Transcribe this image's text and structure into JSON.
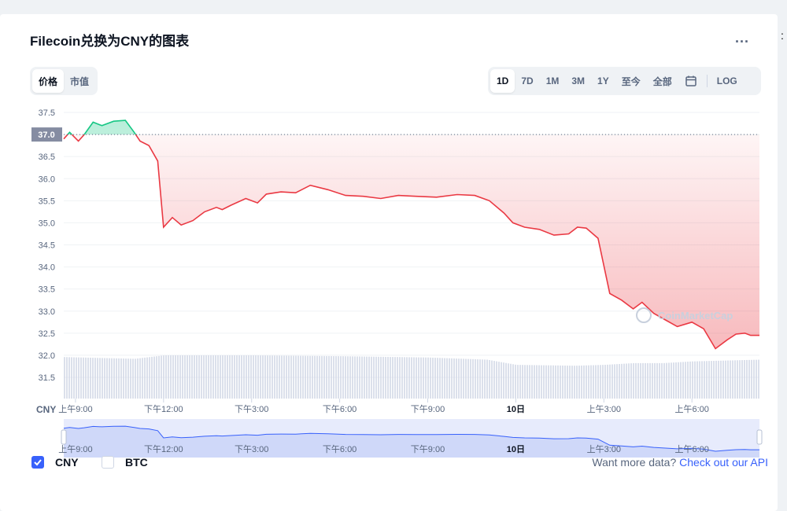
{
  "header": {
    "title": "Filecoin兑换为CNY的图表",
    "more_label": "..."
  },
  "metric_tabs": [
    {
      "label": "价格",
      "active": true
    },
    {
      "label": "市值",
      "active": false
    }
  ],
  "range_tabs": [
    {
      "label": "1D",
      "active": true
    },
    {
      "label": "7D",
      "active": false
    },
    {
      "label": "1M",
      "active": false
    },
    {
      "label": "3M",
      "active": false
    },
    {
      "label": "1Y",
      "active": false
    },
    {
      "label": "至今",
      "active": false
    },
    {
      "label": "全部",
      "active": false
    }
  ],
  "log_label": "LOG",
  "footer": {
    "options": [
      {
        "label": "CNY",
        "checked": true
      },
      {
        "label": "BTC",
        "checked": false
      }
    ],
    "api_text": "Want more data?",
    "api_link": "Check out our API"
  },
  "watermark": "CoinMarketCap",
  "colors": {
    "up": "#16c784",
    "down": "#ea3943",
    "accent": "#3861fb",
    "navigator_fill": "#dde3fb",
    "volume": "#cfd6e4"
  },
  "chart_data": {
    "type": "line",
    "ylabel": "CNY",
    "reference_price": 37.0,
    "ylim": [
      31.0,
      37.7
    ],
    "y_ticks": [
      "37.5",
      "37.0",
      "36.5",
      "36.0",
      "35.5",
      "35.0",
      "34.5",
      "34.0",
      "33.5",
      "33.0",
      "32.5",
      "32.0",
      "31.5"
    ],
    "x_ticks": [
      "上午9:00",
      "下午12:00",
      "下午3:00",
      "下午6:00",
      "下午9:00",
      "10日",
      "上午3:00",
      "上午6:00"
    ],
    "x_tick_hours": [
      0,
      3,
      6,
      9,
      12,
      15,
      18,
      21
    ],
    "x_range_hours": [
      -0.4,
      23.3
    ],
    "series": [
      {
        "hours": [
          -0.4,
          -0.2,
          0.1,
          0.3,
          0.6,
          0.9,
          1.3,
          1.7,
          2.0,
          2.2,
          2.5,
          2.8,
          3.0,
          3.3,
          3.6,
          4.0,
          4.4,
          4.8,
          5.0,
          5.3,
          5.8,
          6.2,
          6.5,
          7.0,
          7.5,
          8.0,
          8.6,
          9.2,
          9.8,
          10.4,
          11.0,
          11.6,
          12.3,
          13.0,
          13.6,
          14.1,
          14.6,
          14.9,
          15.3,
          15.8,
          16.3,
          16.8,
          17.1,
          17.4,
          17.8,
          18.2,
          18.6,
          19.0,
          19.3,
          19.7,
          20.1,
          20.5,
          21.0,
          21.4,
          21.8,
          22.2,
          22.5,
          22.8,
          23.0,
          23.3
        ],
        "values": [
          36.9,
          37.05,
          36.85,
          37.0,
          37.28,
          37.2,
          37.3,
          37.32,
          37.05,
          36.85,
          36.75,
          36.4,
          34.9,
          35.12,
          34.95,
          35.05,
          35.25,
          35.35,
          35.3,
          35.4,
          35.55,
          35.45,
          35.65,
          35.7,
          35.68,
          35.85,
          35.75,
          35.62,
          35.6,
          35.55,
          35.62,
          35.6,
          35.58,
          35.64,
          35.62,
          35.5,
          35.22,
          35.0,
          34.9,
          34.85,
          34.72,
          34.75,
          34.9,
          34.88,
          34.65,
          33.4,
          33.25,
          33.05,
          33.2,
          32.95,
          32.8,
          32.65,
          32.75,
          32.6,
          32.15,
          32.35,
          32.48,
          32.5,
          32.45,
          32.45
        ]
      }
    ],
    "volume": {
      "hours": [
        -0.4,
        2.0,
        3.0,
        6.0,
        9.0,
        12.0,
        14.0,
        15.0,
        17.0,
        18.0,
        19.0,
        20.0,
        21.0,
        23.3
      ],
      "relative_level": [
        0.96,
        0.92,
        1.0,
        1.0,
        0.98,
        0.95,
        0.9,
        0.78,
        0.76,
        0.78,
        0.82,
        0.82,
        0.86,
        0.9
      ]
    },
    "grid": true,
    "legend": "none"
  }
}
